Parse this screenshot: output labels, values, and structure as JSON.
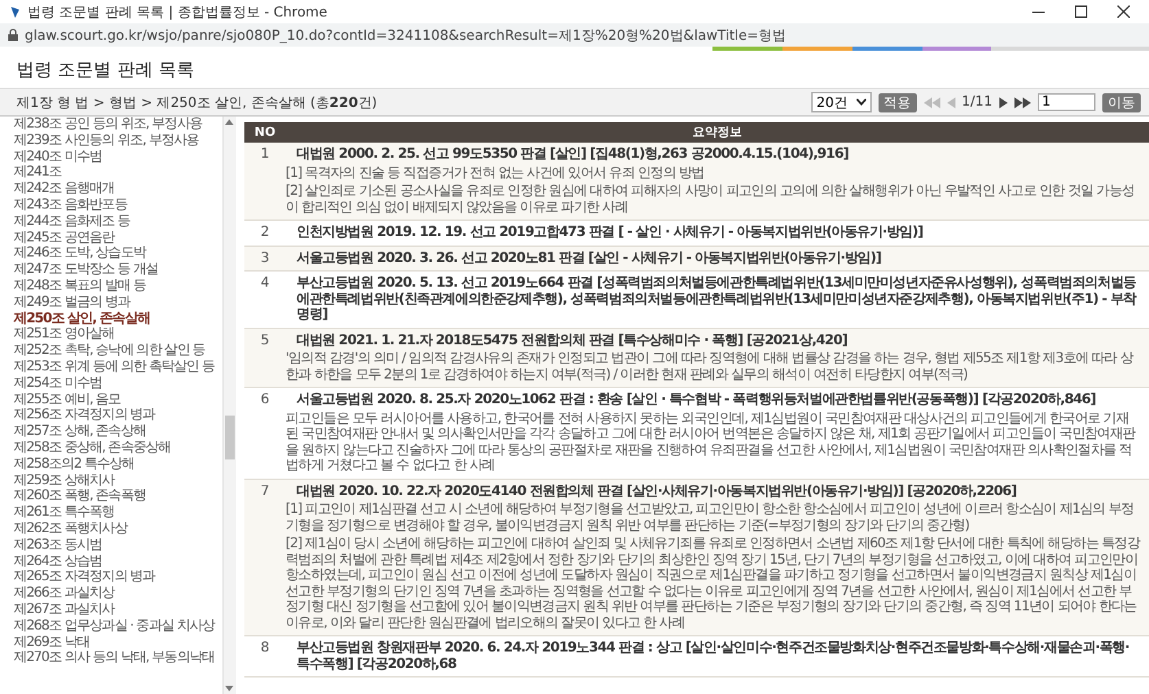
{
  "browser": {
    "title": "법령 조문별 판례 목록 | 종합법률정보 - Chrome",
    "url": "glaw.scourt.go.kr/wsjo/panre/sjo080P_10.do?contId=3241108&searchResult=제1장%20형%20법&lawTitle=형법"
  },
  "page_title": "법령 조문별 판례 목록",
  "breadcrumb": "제1장 형 법 > 형법 > 제250조 살인, 존속살해 (총**220**건)",
  "pager": {
    "page_size": "20건",
    "apply": "적용",
    "page": "1/11",
    "page_input": "1",
    "go": "이동"
  },
  "sidebar": {
    "items": [
      {
        "label": "제238조 공인 등의 위조, 부정사용",
        "selected": false
      },
      {
        "label": "제239조 사인등의 위조, 부정사용",
        "selected": false
      },
      {
        "label": "제240조 미수범",
        "selected": false
      },
      {
        "label": "제241조",
        "selected": false
      },
      {
        "label": "제242조 음행매개",
        "selected": false
      },
      {
        "label": "제243조 음화반포등",
        "selected": false
      },
      {
        "label": "제244조 음화제조 등",
        "selected": false
      },
      {
        "label": "제245조 공연음란",
        "selected": false
      },
      {
        "label": "제246조 도박, 상습도박",
        "selected": false
      },
      {
        "label": "제247조 도박장소 등 개설",
        "selected": false
      },
      {
        "label": "제248조 복표의 발매 등",
        "selected": false
      },
      {
        "label": "제249조 벌금의 병과",
        "selected": false
      },
      {
        "label": "제250조 살인, 존속살해",
        "selected": true
      },
      {
        "label": "제251조 영아살해",
        "selected": false
      },
      {
        "label": "제252조 촉탁, 승낙에 의한 살인 등",
        "selected": false
      },
      {
        "label": "제253조 위계 등에 의한 촉탁살인 등",
        "selected": false
      },
      {
        "label": "제254조 미수범",
        "selected": false
      },
      {
        "label": "제255조 예비, 음모",
        "selected": false
      },
      {
        "label": "제256조 자격정지의 병과",
        "selected": false
      },
      {
        "label": "제257조 상해, 존속상해",
        "selected": false
      },
      {
        "label": "제258조 중상해, 존속중상해",
        "selected": false
      },
      {
        "label": "제258조의2 특수상해",
        "selected": false
      },
      {
        "label": "제259조 상해치사",
        "selected": false
      },
      {
        "label": "제260조 폭행, 존속폭행",
        "selected": false
      },
      {
        "label": "제261조 특수폭행",
        "selected": false
      },
      {
        "label": "제262조 폭행치사상",
        "selected": false
      },
      {
        "label": "제263조 동시범",
        "selected": false
      },
      {
        "label": "제264조 상습범",
        "selected": false
      },
      {
        "label": "제265조 자격정지의 병과",
        "selected": false
      },
      {
        "label": "제266조 과실치상",
        "selected": false
      },
      {
        "label": "제267조 과실치사",
        "selected": false
      },
      {
        "label": "제268조 업무상과실 · 중과실 치사상",
        "selected": false
      },
      {
        "label": "제269조 낙태",
        "selected": false
      },
      {
        "label": "제270조 의사 등의 낙태, 부동의낙태",
        "selected": false
      }
    ]
  },
  "table": {
    "columns": [
      "NO",
      "요약정보"
    ],
    "rows": [
      {
        "no": "1",
        "title": "대법원 2000. 2. 25. 선고 99도5350 판결 [살인] [집48(1)형,263 공2000.4.15.(104),916]",
        "summary": [
          "[1] 목격자의 진술 등 직접증거가 전혀 없는 사건에 있어서 유죄 인정의 방법",
          "[2] 살인죄로 기소된 공소사실을 유죄로 인정한 원심에 대하여 피해자의 사망이 피고인의 고의에 의한 살해행위가 아닌 우발적인 사고로 인한 것일 가능성이 합리적인 의심 없이 배제되지 않았음을 이유로 파기한 사례"
        ]
      },
      {
        "no": "2",
        "title": "인천지방법원 2019. 12. 19. 선고 2019고합473 판결 [ - 살인 · 사체유기 - 아동복지법위반(아동유기·방임)]"
      },
      {
        "no": "3",
        "title": "서울고등법원 2020. 3. 26. 선고 2020노81 판결 [살인 - 사체유기 - 아동복지법위반(아동유기·방임)]"
      },
      {
        "no": "4",
        "title": "부산고등법원 2020. 5. 13. 선고 2019노664 판결 [성폭력범죄의처벌등에관한특례법위반(13세미만미성년자준유사성행위), 성폭력범죄의처벌등에관한특례법위반(친족관계에의한준강제추행), 성폭력범죄의처벌등에관한특례법위반(13세미만미성년자준강제추행), 아동복지법위반(주1) - 부착명령]"
      },
      {
        "no": "5",
        "title": "대법원 2021. 1. 21.자 2018도5475 전원합의체 판결 [특수상해미수 · 폭행] [공2021상,420]",
        "summary": [
          "'임의적 감경'의 의미 / 임의적 감경사유의 존재가 인정되고 법관이 그에 따라 징역형에 대해 법률상 감경을 하는 경우, 형법 제55조 제1항 제3호에 따라 상한과 하한을 모두 2분의 1로 감경하여야 하는지 여부(적극) / 이러한 현재 판례와 실무의 해석이 여전히 타당한지 여부(적극)"
        ]
      },
      {
        "no": "6",
        "title": "서울고등법원 2020. 8. 25.자 2020노1062 판결 : 환송 [살인 · 특수협박 - 폭력행위등처벌에관한법률위반(공동폭행)] [각공2020하,846]",
        "summary": [
          "피고인들은 모두 러시아어를 사용하고, 한국어를 전혀 사용하지 못하는 외국인인데, 제1심법원이 국민참여재판 대상사건의 피고인들에게 한국어로 기재된 국민참여재판 안내서 및 의사확인서만을 각각 송달하고 그에 대한 러시아어 번역본은 송달하지 않은 채, 제1회 공판기일에서 피고인들이 국민참여재판을 원하지 않는다고 진술하자 그에 따라 통상의 공판절차로 재판을 진행하여 유죄판결을 선고한 사안에서, 제1심법원이 국민참여재판 의사확인절차를 적법하게 거쳤다고 볼 수 없다고 한 사례"
        ]
      },
      {
        "no": "7",
        "title": "대법원 2020. 10. 22.자 2020도4140 전원합의체 판결 [살인·사체유기·아동복지법위반(아동유기·방임)] [공2020하,2206]",
        "summary": [
          "[1] 피고인이 제1심판결 선고 시 소년에 해당하여 부정기형을 선고받았고, 피고인만이 항소한 항소심에서 피고인이 성년에 이르러 항소심이 제1심의 부정기형을 정기형으로 변경해야 할 경우, 불이익변경금지 원칙 위반 여부를 판단하는 기준(=부정기형의 장기와 단기의 중간형)",
          "[2] 제1심이 당시 소년에 해당하는 피고인에 대하여 살인죄 및 사체유기죄를 유죄로 인정하면서 소년법 제60조 제1항 단서에 대한 특칙에 해당하는 특정강력범죄의 처벌에 관한 특례법 제4조 제2항에서 정한 장기와 단기의 최상한인 징역 장기 15년, 단기 7년의 부정기형을 선고하였고, 이에 대하여 피고인만이 항소하였는데, 피고인이 원심 선고 이전에 성년에 도달하자 원심이 직권으로 제1심판결을 파기하고 정기형을 선고하면서 불이익변경금지 원칙상 제1심이 선고한 부정기형의 단기인 징역 7년을 초과하는 징역형을 선고할 수 없다는 이유로 피고인에게 징역 7년을 선고한 사안에서, 원심이 제1심에서 선고한 부정기형 대신 정기형을 선고함에 있어 불이익변경금지 원칙 위반 여부를 판단하는 기준은 부정기형의 장기와 단기의 중간형, 즉 징역 11년이 되어야 한다는 이유로, 이와 달리 판단한 원심판결에 법리오해의 잘못이 있다고 한 사례"
        ]
      },
      {
        "no": "8",
        "title": "부산고등법원 창원재판부 2020. 6. 24.자 2019노344 판결 : 상고 [살인·살인미수·현주건조물방화치상·현주건조물방화·특수상해·재물손괴·폭행·특수폭행] [각공2020하,68"
      }
    ]
  }
}
